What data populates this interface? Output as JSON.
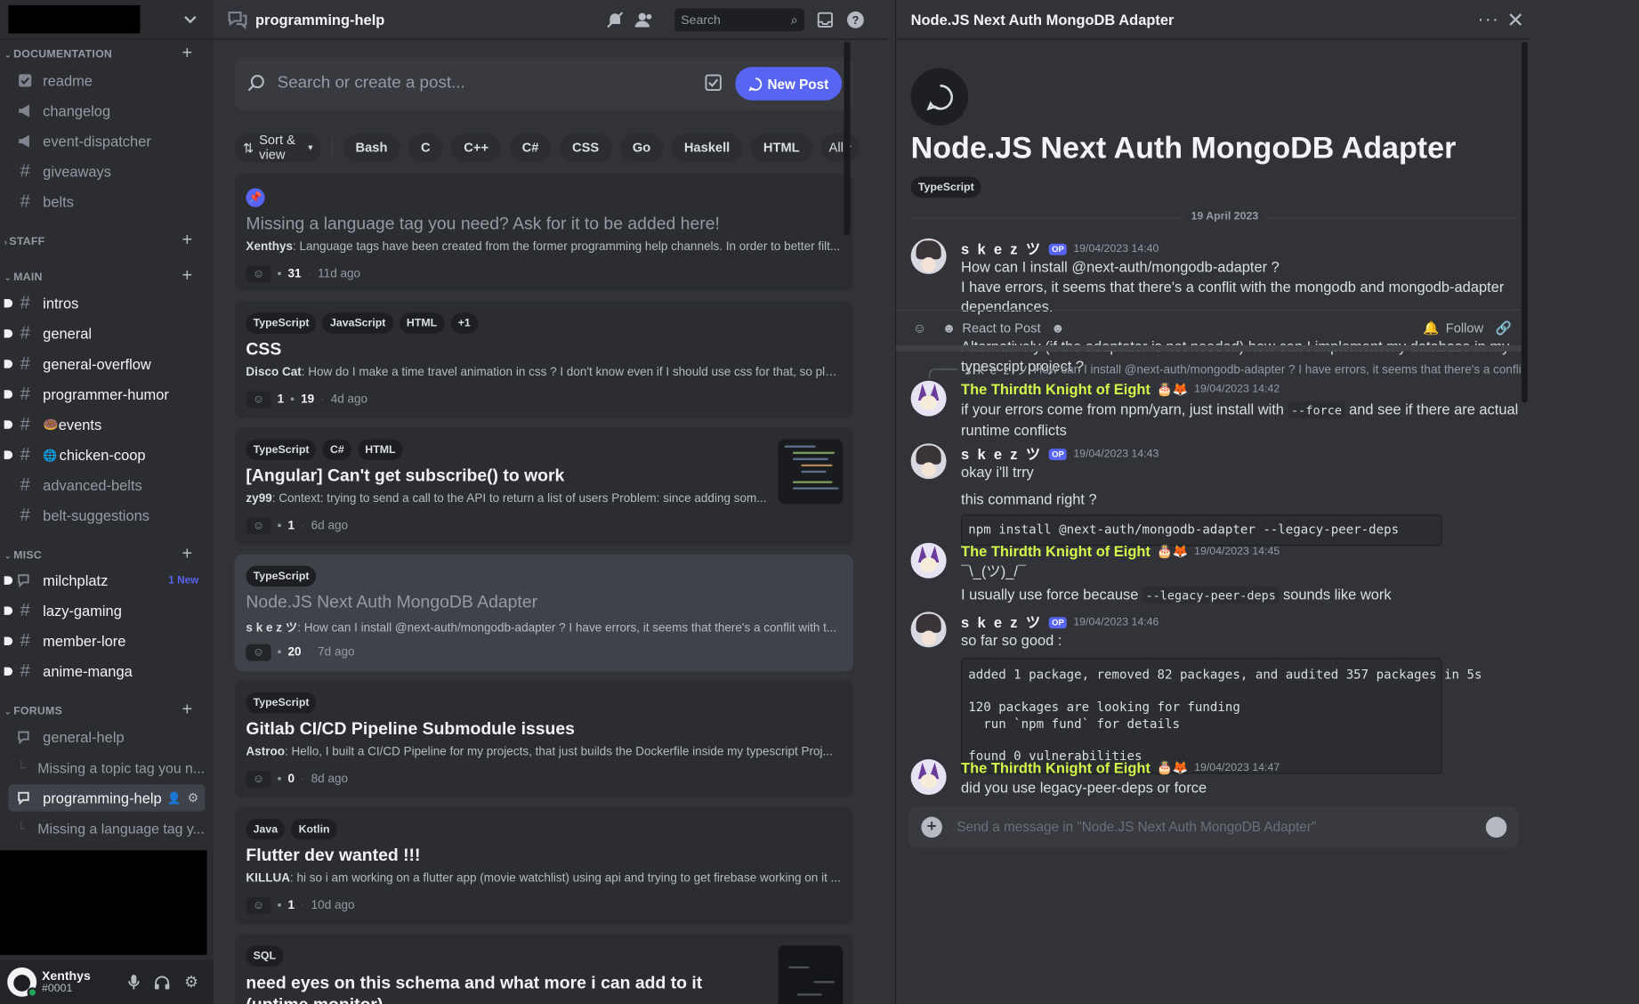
{
  "colors": {
    "accent": "#5865f2",
    "bg": "#313338",
    "sidebar": "#2b2d31",
    "knight_name": "#d4f64a",
    "online": "#23a55a"
  },
  "sidebar": {
    "categories": {
      "documentation": "DOCUMENTATION",
      "staff": "STAFF",
      "main": "MAIN",
      "misc": "MISC",
      "forums": "FORUMS"
    },
    "doc_channels": [
      "readme",
      "changelog",
      "event-dispatcher",
      "giveaways",
      "belts"
    ],
    "main_channels": [
      "intros",
      "general",
      "general-overflow",
      "programmer-humor",
      "events",
      "chicken-coop",
      "advanced-belts",
      "belt-suggestions"
    ],
    "misc_channels": [
      "milchplatz",
      "lazy-gaming",
      "member-lore",
      "anime-manga"
    ],
    "misc_new_badge": "1 New",
    "forum_channels": [
      "general-help",
      "programming-help"
    ],
    "forum_threads": [
      "Missing a topic tag you n...",
      "Missing a language tag y..."
    ],
    "events_emoji": "🍩",
    "chicken_emoji": "🌐",
    "user": {
      "name": "Xenthys",
      "tag": "#0001"
    }
  },
  "forum": {
    "title": "programming-help",
    "search_placeholder": "Search",
    "post_search_placeholder": "Search or create a post...",
    "new_post": "New Post",
    "sort_label": "Sort & view",
    "filter_tags": [
      "Bash",
      "C",
      "C++",
      "C#",
      "CSS",
      "Go",
      "Haskell",
      "HTML"
    ],
    "all_label": "All",
    "posts": [
      {
        "tags": [],
        "title": "Missing a language tag you need? Ask for it to be added here!",
        "author": "Xenthys",
        "snippet": "Language tags have been created from the former programming help channels. In order to better filt...",
        "reactions": "",
        "comments": "31",
        "age": "11d ago"
      },
      {
        "tags": [
          "TypeScript",
          "JavaScript",
          "HTML",
          "+1"
        ],
        "title": "CSS",
        "author": "Disco Cat",
        "snippet": "How do I make a time travel animation in css ? I don't know even if I should use css for that, so pleas...",
        "reactions": "1",
        "comments": "19",
        "age": "4d ago"
      },
      {
        "tags": [
          "TypeScript",
          "C#",
          "HTML"
        ],
        "title": "[Angular] Can't get subscribe() to work",
        "author": "zy99",
        "snippet": "Context: trying to send a call to the API to return a list of users Problem: since adding som...",
        "reactions": "",
        "comments": "1",
        "age": "6d ago"
      },
      {
        "tags": [
          "TypeScript"
        ],
        "title": "Node.JS Next Auth MongoDB Adapter",
        "author": "s k e z ツ",
        "snippet": "How can I install @next-auth/mongodb-adapter ? I have errors, it seems that there's a conflit with t...",
        "reactions": "",
        "comments": "20",
        "age": "7d ago"
      },
      {
        "tags": [
          "TypeScript"
        ],
        "title": "Gitlab CI/CD Pipeline Submodule issues",
        "author": "Astroo",
        "snippet": "Hello, I built a CI/CD Pipeline for my projects, that just builds the Dockerfile inside my typescript Proj...",
        "reactions": "",
        "comments": "0",
        "age": "8d ago"
      },
      {
        "tags": [
          "Java",
          "Kotlin"
        ],
        "title": "Flutter dev wanted !!!",
        "author": "KILLUA",
        "snippet": "hi so i am working on a flutter app (movie watchlist) using api and trying to get firebase working on it ...",
        "reactions": "",
        "comments": "1",
        "age": "10d ago"
      },
      {
        "tags": [
          "SQL"
        ],
        "title": "need eyes on this schema and what more i can add to it (uptime monitor)",
        "author": "",
        "snippet": "",
        "reactions": "",
        "comments": "",
        "age": ""
      }
    ]
  },
  "thread": {
    "header_title": "Node.JS Next Auth MongoDB Adapter",
    "title": "Node.JS Next Auth MongoDB Adapter",
    "tag": "TypeScript",
    "date_divider": "19 April 2023",
    "op_badge": "OP",
    "react_label": "React to Post",
    "follow_label": "Follow",
    "composer_placeholder": "Send a message in \"Node.JS Next Auth MongoDB Adapter\"",
    "op_message": {
      "author": "s k e z ツ",
      "time": "19/04/2023 14:40",
      "line1": "How can I install @next-auth/mongodb-adapter ?",
      "line2": "I have errors, it seems that there's a conflit with the mongodb and mongodb-adapter dependances.",
      "line3": "Alternatively (if the adaptater is not needed) how can I implement my database in my typescript project ?"
    },
    "reply1": {
      "quoted_author": "s k e z ツ",
      "quoted_text": "How can I install @next-auth/mongodb-adapter ? I have errors, it seems that there's a conflit with the mo",
      "author": "The Thirdth Knight of Eight",
      "emoji": "🎂🦊",
      "time": "19/04/2023 14:42",
      "pre": "if your errors come from npm/yarn, just install with",
      "code": "--force",
      "post": "and see if there are actual runtime conflicts"
    },
    "reply2": {
      "author": "s k e z ツ",
      "time": "19/04/2023 14:43",
      "line1": "okay i'll trry",
      "line2": "this command right ?",
      "code": "npm install @next-auth/mongodb-adapter --legacy-peer-deps"
    },
    "reply3": {
      "author": "The Thirdth Knight of Eight",
      "emoji": "🎂🦊",
      "time": "19/04/2023 14:45",
      "line1": "¯\\_(ツ)_/¯",
      "pre": "I usually use force because",
      "code": "--legacy-peer-deps",
      "post": "sounds like work"
    },
    "reply4": {
      "author": "s k e z ツ",
      "time": "19/04/2023 14:46",
      "line1": "so far so good :",
      "code": "added 1 package, removed 82 packages, and audited 357 packages in 5s\n\n120 packages are looking for funding\n  run `npm fund` for details\n\nfound 0 vulnerabilities"
    },
    "reply5": {
      "author": "The Thirdth Knight of Eight",
      "emoji": "🎂🦊",
      "time": "19/04/2023 14:47",
      "line1": "did you use legacy-peer-deps or force"
    }
  }
}
